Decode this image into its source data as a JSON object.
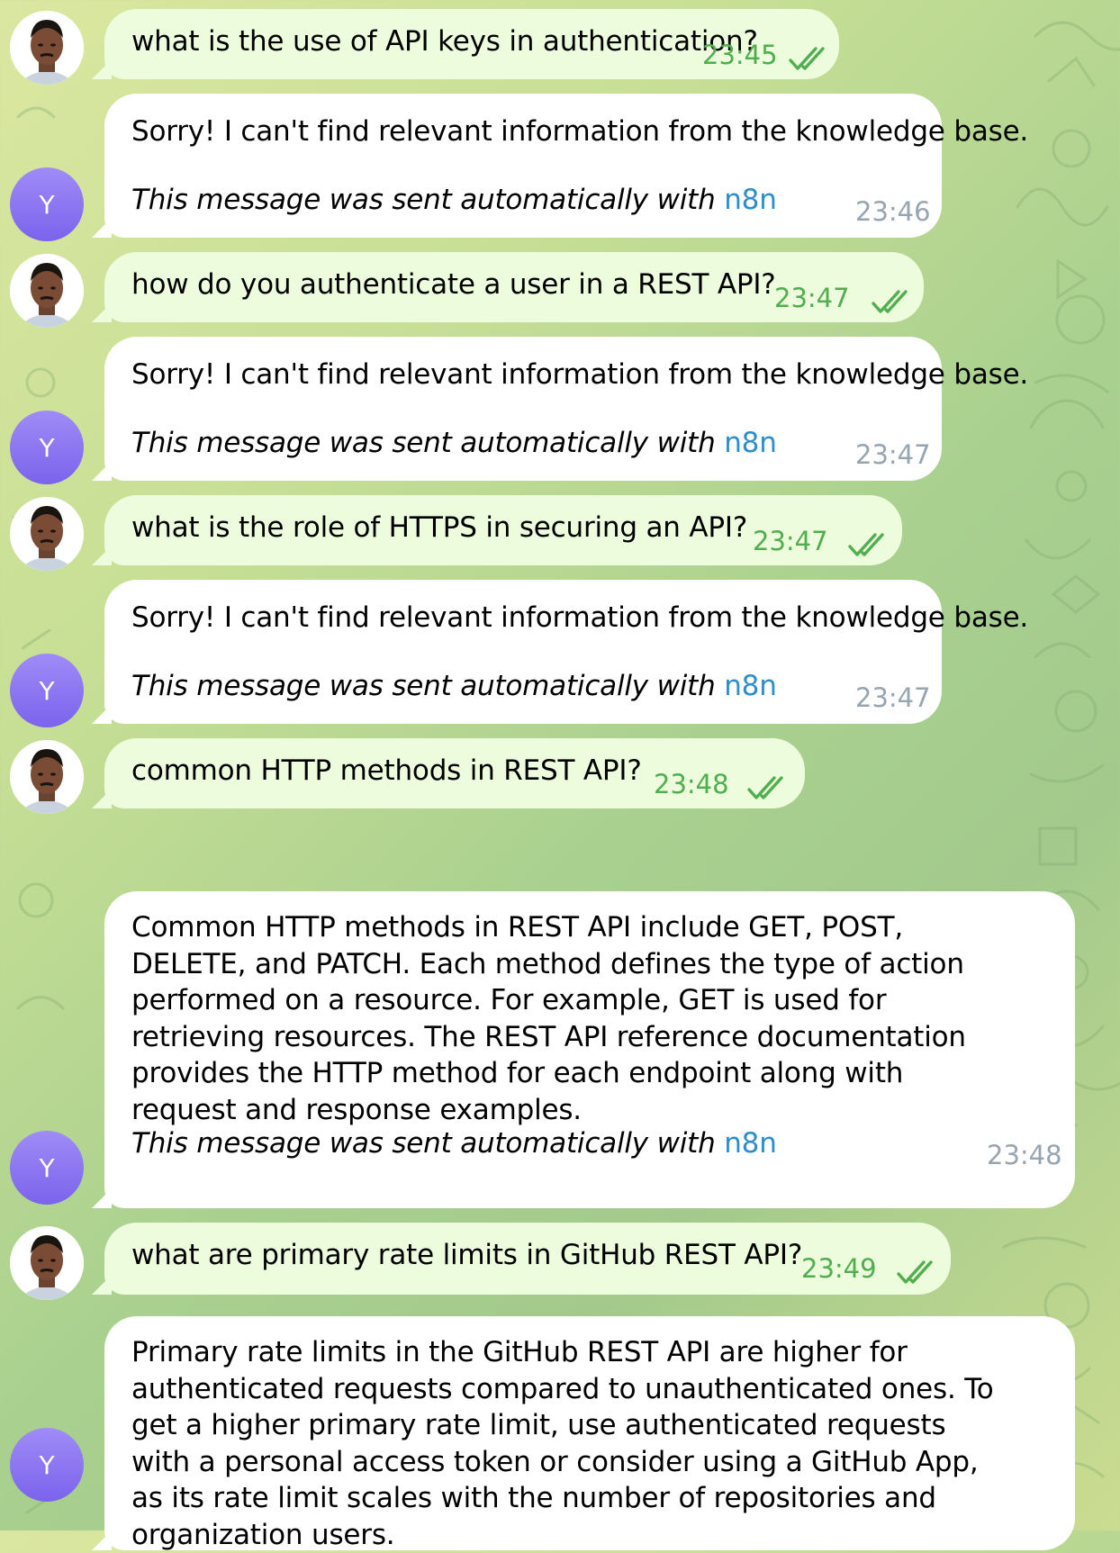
{
  "colors": {
    "outgoing_bubble": "#eefcde",
    "incoming_bubble": "#ffffff",
    "outgoing_time": "#4fae4e",
    "incoming_time": "#96a5b0",
    "link": "#2d8ecf",
    "bot_avatar": "#8b74f0"
  },
  "bot_avatar_letter": "Y",
  "auto_note_prefix": "This message was sent automatically with ",
  "auto_note_link": "n8n",
  "messages": [
    {
      "type": "outgoing",
      "text": "what is the use of API keys in authentication?",
      "time": "23:45"
    },
    {
      "type": "incoming",
      "text": "Sorry! I can't find relevant information from the knowledge base.",
      "time": "23:46"
    },
    {
      "type": "outgoing",
      "text": "how do you authenticate a user in a REST API?",
      "time": "23:47"
    },
    {
      "type": "incoming",
      "text": "Sorry! I can't find relevant information from the knowledge base.",
      "time": "23:47"
    },
    {
      "type": "outgoing",
      "text": "what is the role of HTTPS in securing an API?",
      "time": "23:47"
    },
    {
      "type": "incoming",
      "text": "Sorry! I can't find relevant information from the knowledge base.",
      "time": "23:47"
    },
    {
      "type": "outgoing",
      "text": "common HTTP methods in REST API?",
      "time": "23:48"
    },
    {
      "type": "incoming",
      "text": "Common HTTP methods in REST API include GET, POST, DELETE, and PATCH. Each method defines the type of action performed on a resource. For example, GET is used for retrieving resources. The REST API reference documentation provides the HTTP method for each endpoint along with request and response examples.",
      "time": "23:48"
    },
    {
      "type": "outgoing",
      "text": "what are primary rate limits in GitHub REST API?",
      "time": "23:49"
    },
    {
      "type": "incoming",
      "text": "Primary rate limits in the GitHub REST API are higher for authenticated requests compared to unauthenticated ones. To get a higher primary rate limit, use authenticated requests with a personal access token or consider using a GitHub App, as its rate limit scales with the number of repositories and organization users.",
      "time": ""
    }
  ]
}
